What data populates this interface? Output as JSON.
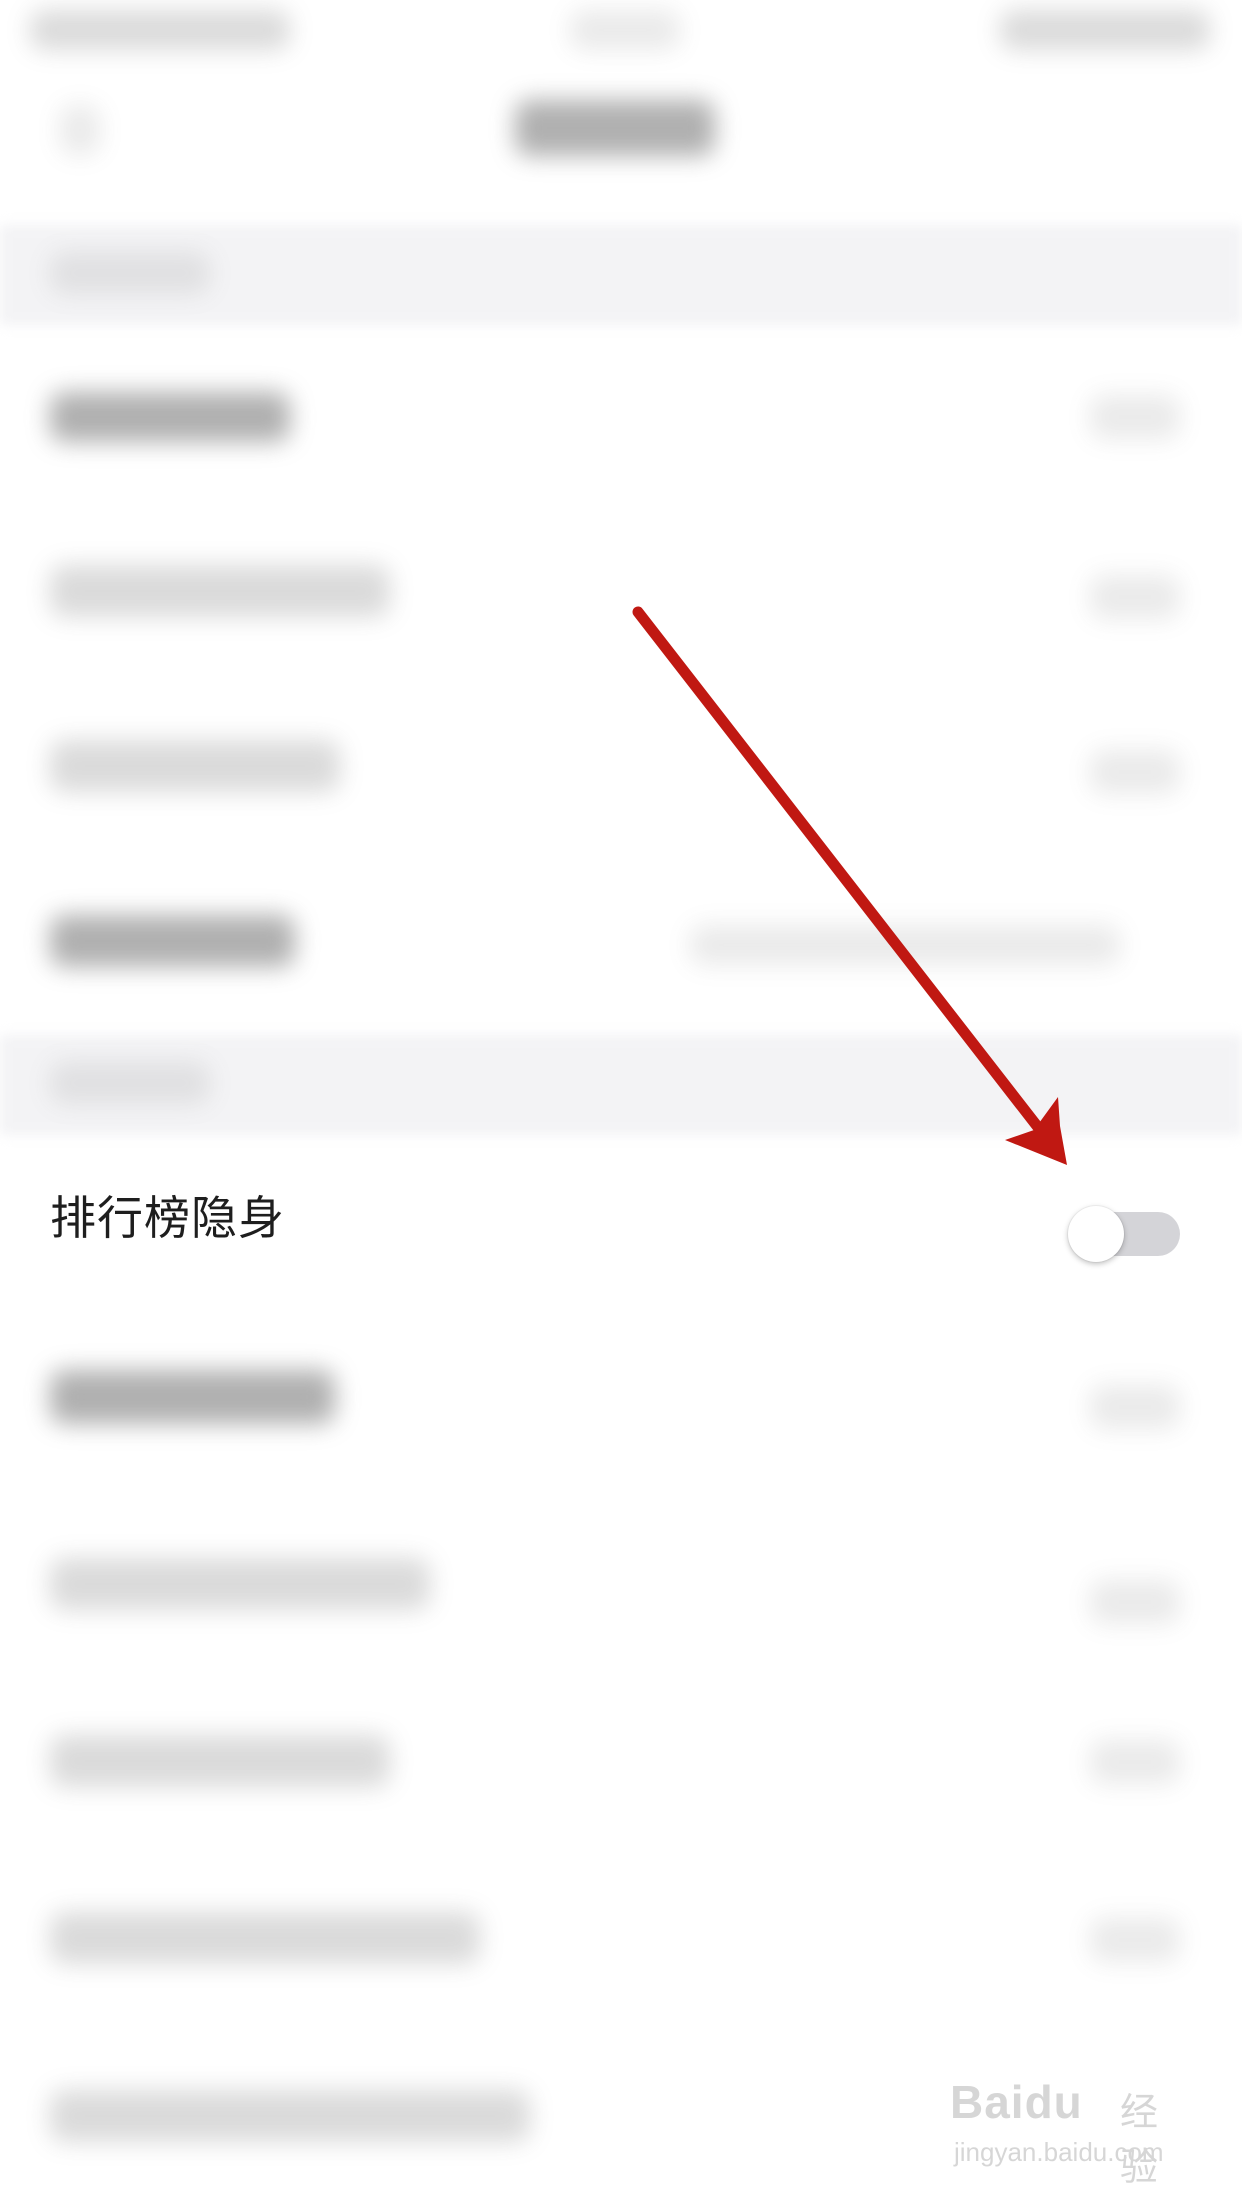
{
  "settings": {
    "invisible_row": {
      "label": "排行榜隐身",
      "toggle_state": "off",
      "toggle_track_color": "#d4d4d8"
    }
  },
  "annotation": {
    "arrow_color": "#c01812"
  },
  "watermark": {
    "brand": "Baidu",
    "product": "经验",
    "url": "jingyan.baidu.com"
  }
}
